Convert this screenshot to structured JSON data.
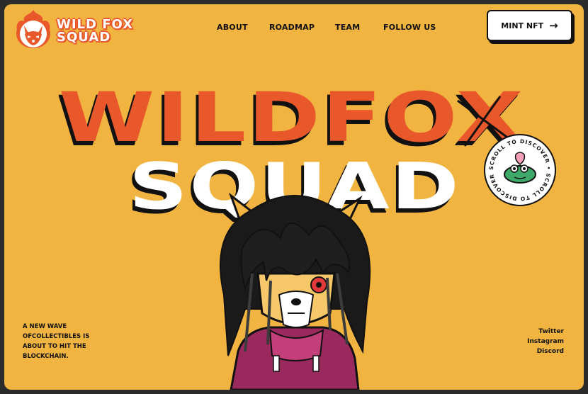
{
  "brand": {
    "name": "WILD FOX\nSQUAD",
    "colors": {
      "background": "#f2b441",
      "accent": "#e8582a",
      "ink": "#111111",
      "white": "#ffffff"
    }
  },
  "nav": {
    "items": [
      "ABOUT",
      "ROADMAP",
      "TEAM",
      "FOLLOW US"
    ]
  },
  "cta": {
    "label": "MINT NFT",
    "icon": "arrow-right-icon"
  },
  "hero": {
    "title_line1": "WILDFOX",
    "title_line2": "SQUAD"
  },
  "badge": {
    "text": "SCROLL TO DISCOVER • SCROLL TO DISCOVER •",
    "icon": "frog-sticker-icon"
  },
  "tagline": "A NEW WAVE OFCOLLECTIBLES IS ABOUT TO HIT THE BLOCKCHAIN.",
  "socials": [
    "Twitter",
    "Instagram",
    "Discord"
  ]
}
